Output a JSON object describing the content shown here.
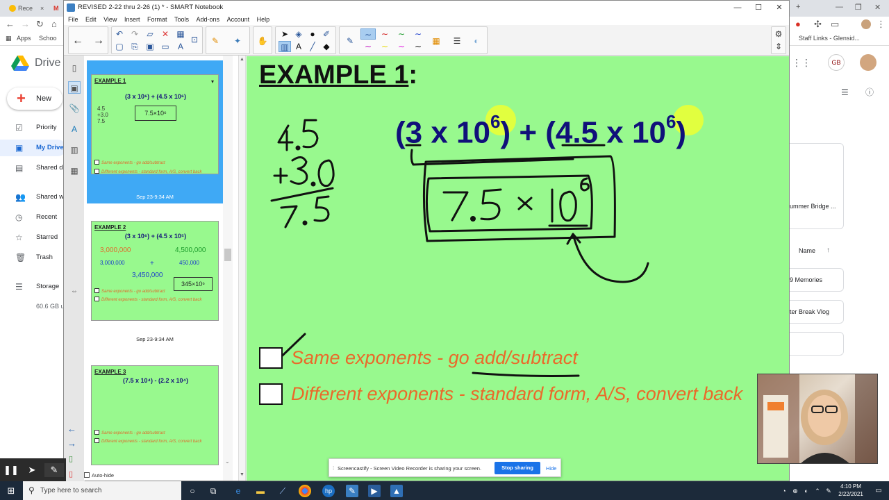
{
  "chrome": {
    "tabs": [
      "Rece",
      "M"
    ],
    "bookmarks": [
      "Apps",
      "Schoo",
      "Staff Links - Glensid..."
    ]
  },
  "drive": {
    "title": "Drive",
    "new_label": "New",
    "nav": [
      "Priority",
      "My Drive",
      "Shared d",
      "Shared w",
      "Recent",
      "Starred",
      "Trash",
      "Storage"
    ],
    "storage_text": "60.6 GB u",
    "file_cards": [
      "ummer Bridge ...",
      "9 Memories",
      "ter Break Vlog"
    ],
    "sort_label": "Name"
  },
  "notebook": {
    "window_title": "REVISED 2-22 thru 2-26 (1) * - SMART Notebook",
    "menu": [
      "File",
      "Edit",
      "View",
      "Insert",
      "Format",
      "Tools",
      "Add-ons",
      "Account",
      "Help"
    ],
    "thumbnails": [
      {
        "title": "EXAMPLE 1",
        "expr": "(3 x 10⁶) + (4.5 x 10⁶)",
        "date": "Sep 23-9:34 AM"
      },
      {
        "title": "EXAMPLE 2",
        "expr": "(3 x 10⁶) + (4.5 x 10⁵)",
        "date": "Sep 23-9:34 AM"
      },
      {
        "title": "EXAMPLE 3",
        "expr": "(7.5 x 10⁴) - (2.2 x 10⁴)",
        "date": ""
      }
    ],
    "thumb_cb1": "Same exponents - go add/subtract",
    "thumb_cb2": "Different exponents - standard form, A/S, convert back",
    "autohide": "Auto-hide",
    "page": {
      "title": "EXAMPLE 1",
      "title_colon": ":",
      "expr_part1": "(3 x 10",
      "expr_exp1": "6",
      "expr_part2": ") + (4.5 x 10",
      "expr_exp2": "6",
      "expr_part3": ")",
      "checkbox1": "Same exponents - go add/subtract",
      "checkbox2": "Different exponents - standard form, A/S, convert back"
    }
  },
  "share_bar": {
    "text": "Screencastify - Screen Video Recorder is sharing your screen.",
    "stop": "Stop sharing",
    "hide": "Hide"
  },
  "taskbar": {
    "search_placeholder": "Type here to search",
    "time": "4:10 PM",
    "date": "2/22/2021"
  },
  "colors": {
    "canvas_bg": "#98f98e",
    "expression": "#10107a",
    "checkbox_text": "#ea6a2a",
    "highlight": "#e5ff3b",
    "sorter_selected": "#3fa9f5"
  }
}
